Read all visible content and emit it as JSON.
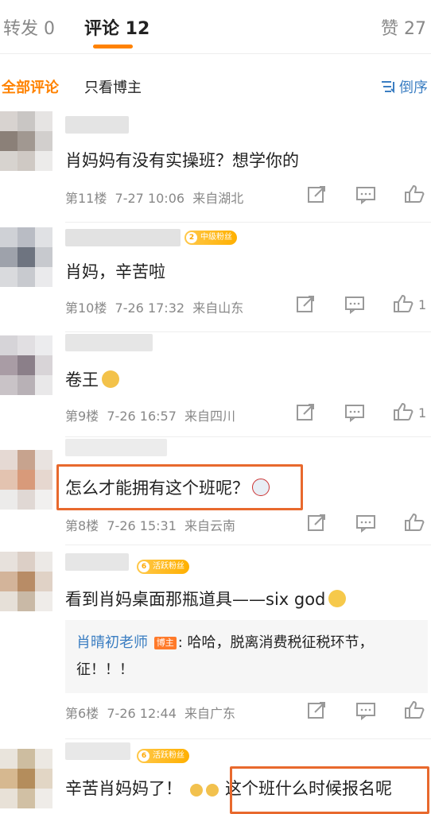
{
  "tabs": {
    "repost": "转发 0",
    "comments": "评论 12",
    "likes": "赞 27"
  },
  "filters": {
    "all": "全部评论",
    "author_only": "只看博主",
    "sort": "倒序"
  },
  "comments": [
    {
      "text": "肖妈妈有没有实操班？想学你的",
      "floor": "第11楼",
      "time": "7-27 10:06",
      "location": "来自湖北",
      "likes": ""
    },
    {
      "badge": "中级粉丝",
      "badge_level": "2",
      "text": "肖妈，辛苦啦",
      "floor": "第10楼",
      "time": "7-26 17:32",
      "location": "来自山东",
      "likes": "1"
    },
    {
      "text": "卷王",
      "floor": "第9楼",
      "time": "7-26 16:57",
      "location": "来自四川",
      "likes": "1"
    },
    {
      "text": "怎么才能拥有这个班呢？",
      "floor": "第8楼",
      "time": "7-26 15:31",
      "location": "来自云南",
      "likes": ""
    },
    {
      "badge": "活跃粉丝",
      "badge_level": "6",
      "text": "看到肖妈桌面那瓶道具——six god",
      "reply": {
        "name": "肖晴初老师",
        "tag": "博主",
        "text": ": 哈哈，脱离消费税征税环节，征！！！"
      },
      "floor": "第6楼",
      "time": "7-26 12:44",
      "location": "来自广东",
      "likes": ""
    },
    {
      "badge": "活跃粉丝",
      "badge_level": "6",
      "text_a": "辛苦肖妈妈了！",
      "text_b": "这个班什么时候报名呢"
    }
  ]
}
